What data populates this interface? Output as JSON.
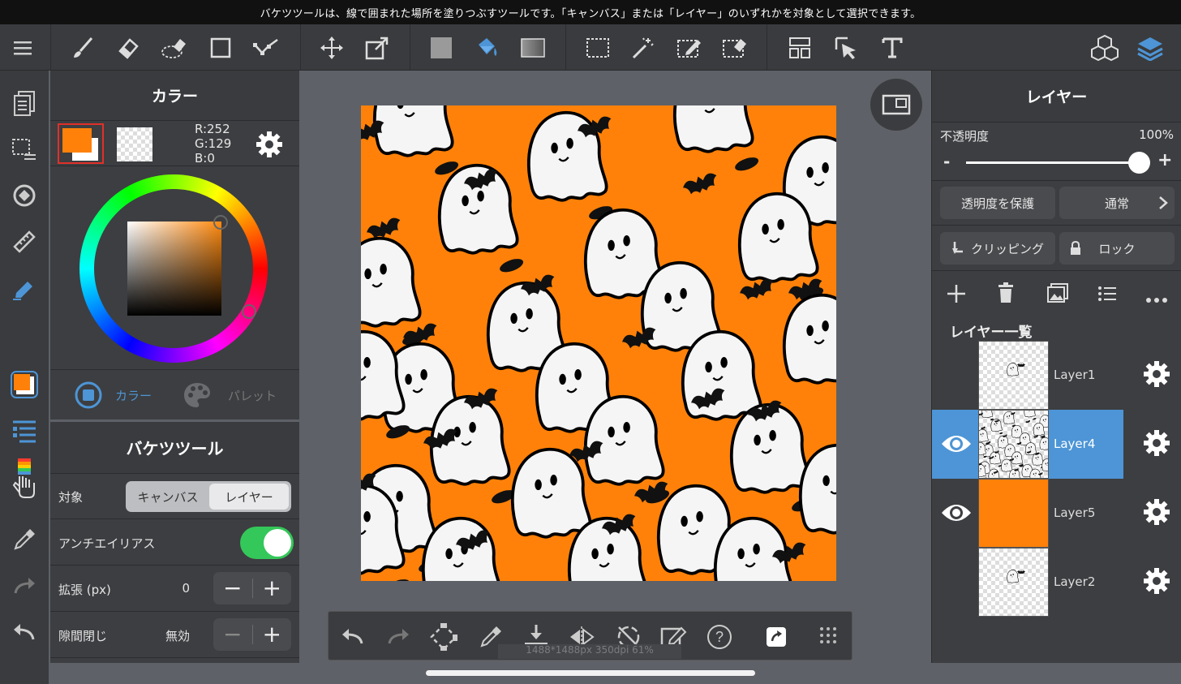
{
  "infobar": {
    "text": "バケツツールは、線で囲まれた場所を塗りつぶすツールです。「キャンバス」または「レイヤー」のいずれかを対象として選択できます。"
  },
  "color_panel": {
    "title": "カラー",
    "rgb": {
      "r": "R:252",
      "g": "G:129",
      "b": "B:0"
    },
    "foreground_color": "#ff8109",
    "tabs": [
      {
        "label": "カラー",
        "active": true
      },
      {
        "label": "パレット",
        "active": false
      }
    ]
  },
  "bucket_panel": {
    "title": "バケツツール",
    "target_label": "対象",
    "target_options": [
      {
        "label": "キャンバス",
        "active": false
      },
      {
        "label": "レイヤー",
        "active": true
      }
    ],
    "antialias_label": "アンチエイリアス",
    "antialias_on": true,
    "expand_label": "拡張 (px)",
    "expand_value": "0",
    "gap_label": "隙間閉じ",
    "gap_value": "無効"
  },
  "canvas": {
    "info": "1488*1488px 350dpi 61%",
    "fill_color": "#ff8109"
  },
  "layer_panel": {
    "title": "レイヤー",
    "opacity_label": "不透明度",
    "opacity_value": "100%",
    "opacity_fraction": 1.0,
    "protect_alpha_label": "透明度を保護",
    "blend_mode_label": "通常",
    "clipping_label": "クリッピング",
    "lock_label": "ロック",
    "list_title": "レイヤー一覧",
    "layers": [
      {
        "name": "Layer1",
        "visible": false,
        "selected": false
      },
      {
        "name": "Layer4",
        "visible": true,
        "selected": true
      },
      {
        "name": "Layer5",
        "visible": true,
        "selected": false
      },
      {
        "name": "Layer2",
        "visible": false,
        "selected": false
      }
    ]
  },
  "colors": {
    "accent": "#4d95d6",
    "orange": "#ff8109",
    "toggle_on": "#34c759",
    "panel": "#3d3e41"
  }
}
